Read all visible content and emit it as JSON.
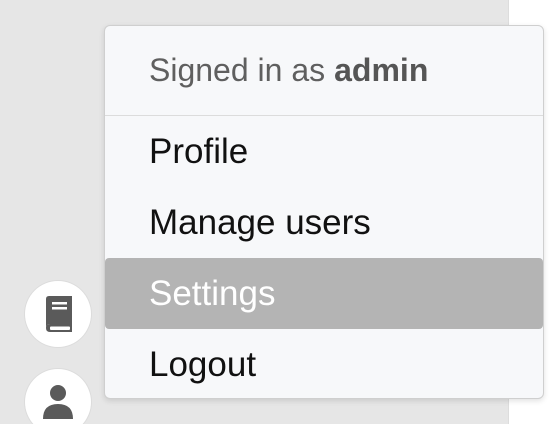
{
  "user_menu": {
    "signed_in_prefix": "Signed in as",
    "username": "admin",
    "items": [
      {
        "label": "Profile"
      },
      {
        "label": "Manage users"
      },
      {
        "label": "Settings",
        "highlighted": true
      },
      {
        "label": "Logout"
      }
    ]
  },
  "sidebar": {
    "buttons": [
      {
        "icon": "book-icon"
      },
      {
        "icon": "user-icon"
      }
    ]
  },
  "colors": {
    "menu_background": "#f7f8fa",
    "highlight_background": "#b4b4b4",
    "highlight_text": "#ffffff",
    "icon_color": "#5a5a5a"
  }
}
